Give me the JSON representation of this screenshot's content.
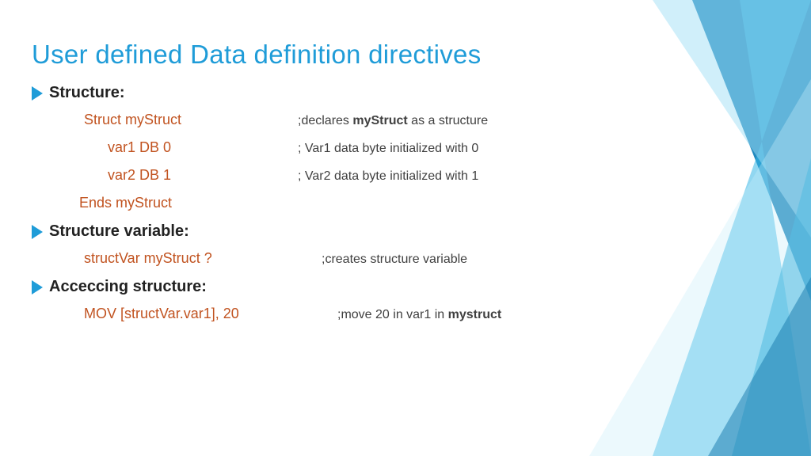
{
  "title": "User defined Data definition directives",
  "sections": {
    "s1": {
      "label": "Structure:"
    },
    "s2": {
      "label": "Structure variable:"
    },
    "s3": {
      "label": "Acceccing structure:"
    }
  },
  "lines": {
    "l1": {
      "code": "Struct myStruct",
      "comment_prefix": ";declares ",
      "comment_bold": "myStruct",
      "comment_suffix": " as a structure"
    },
    "l2": {
      "code": "var1  DB 0",
      "comment": "; Var1 data byte initialized with 0"
    },
    "l3": {
      "code": "var2  DB 1",
      "comment": "; Var2 data byte initialized with 1"
    },
    "l4": {
      "code": "Ends  myStruct"
    },
    "l5": {
      "code": "structVar  myStruct  ?",
      "comment": ";creates structure variable"
    },
    "l6": {
      "code": "MOV [structVar.var1], 20",
      "comment_prefix": ";move 20 in var1 in ",
      "comment_bold": "mystruct"
    }
  }
}
